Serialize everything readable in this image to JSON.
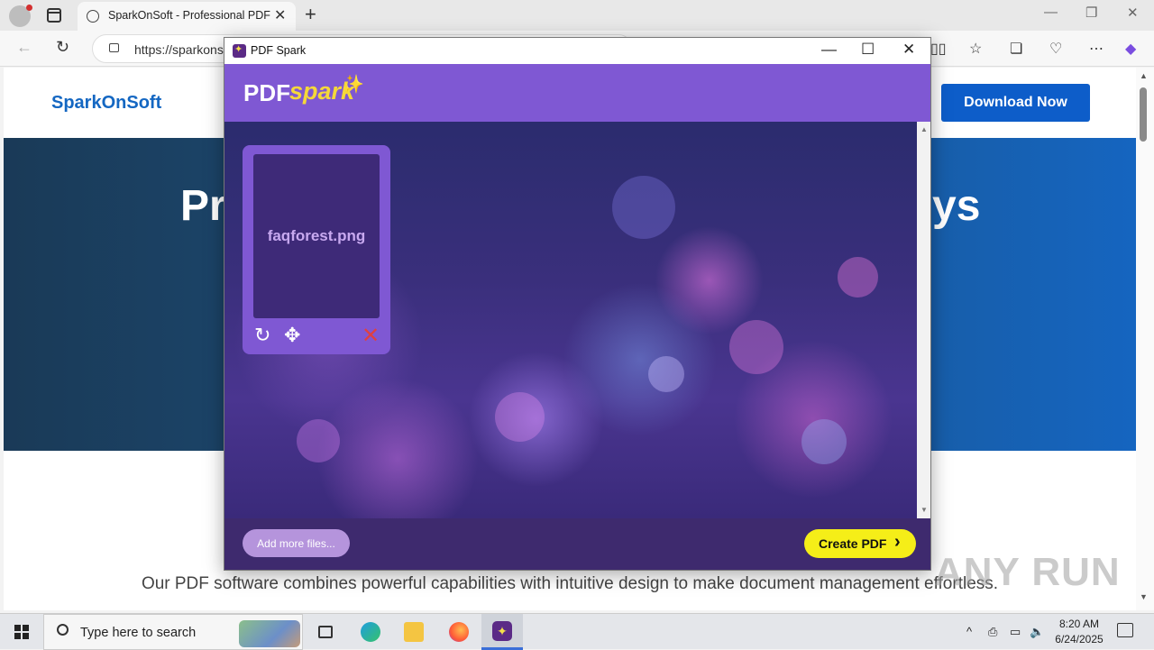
{
  "browser": {
    "tab_title": "SparkOnSoft - Professional PDF Software",
    "url": "https://sparkonsoft.com",
    "new_tab_glyph": "+",
    "tab_close_glyph": "✕",
    "window_controls": {
      "minimize": "—",
      "restore": "❐",
      "close": "✕"
    },
    "nav": {
      "back": "←",
      "reload": "↻"
    },
    "toolbar_icons": [
      "split-screen-icon",
      "favorites-icon",
      "collections-icon",
      "browser-essentials-icon",
      "more-icon",
      "copilot-icon"
    ]
  },
  "page": {
    "logo": "SparkOnSoft",
    "download_button": "Download Now",
    "hero_title_left": "Pr",
    "hero_title_right": "ys",
    "description": "Our PDF software combines powerful capabilities with intuitive design to make document management effortless."
  },
  "app": {
    "window_title": "PDF Spark",
    "controls": {
      "minimize": "—",
      "maximize": "☐",
      "close": "✕"
    },
    "brand_pdf": "PDF",
    "brand_spark": "spark",
    "files": [
      {
        "name": "faqforest.png"
      }
    ],
    "card_icons": {
      "rotate": "↻",
      "move": "✥",
      "remove": "✕"
    },
    "add_files_button": "Add more files...",
    "create_button": "Create PDF",
    "create_chevron": "›"
  },
  "watermark": "ANY RUN",
  "taskbar": {
    "search_placeholder": "Type here to search",
    "apps": [
      "task-view",
      "edge",
      "file-explorer",
      "firefox",
      "pdf-spark"
    ],
    "tray_chevron": "^",
    "clock_time": "8:20 AM",
    "clock_date": "6/24/2025"
  },
  "colors": {
    "brand_blue": "#1467c2",
    "download_button": "#0d5dc9",
    "app_header": "#7f58d3",
    "create_button": "#f5ee18",
    "add_files_button": "#b594dc"
  }
}
